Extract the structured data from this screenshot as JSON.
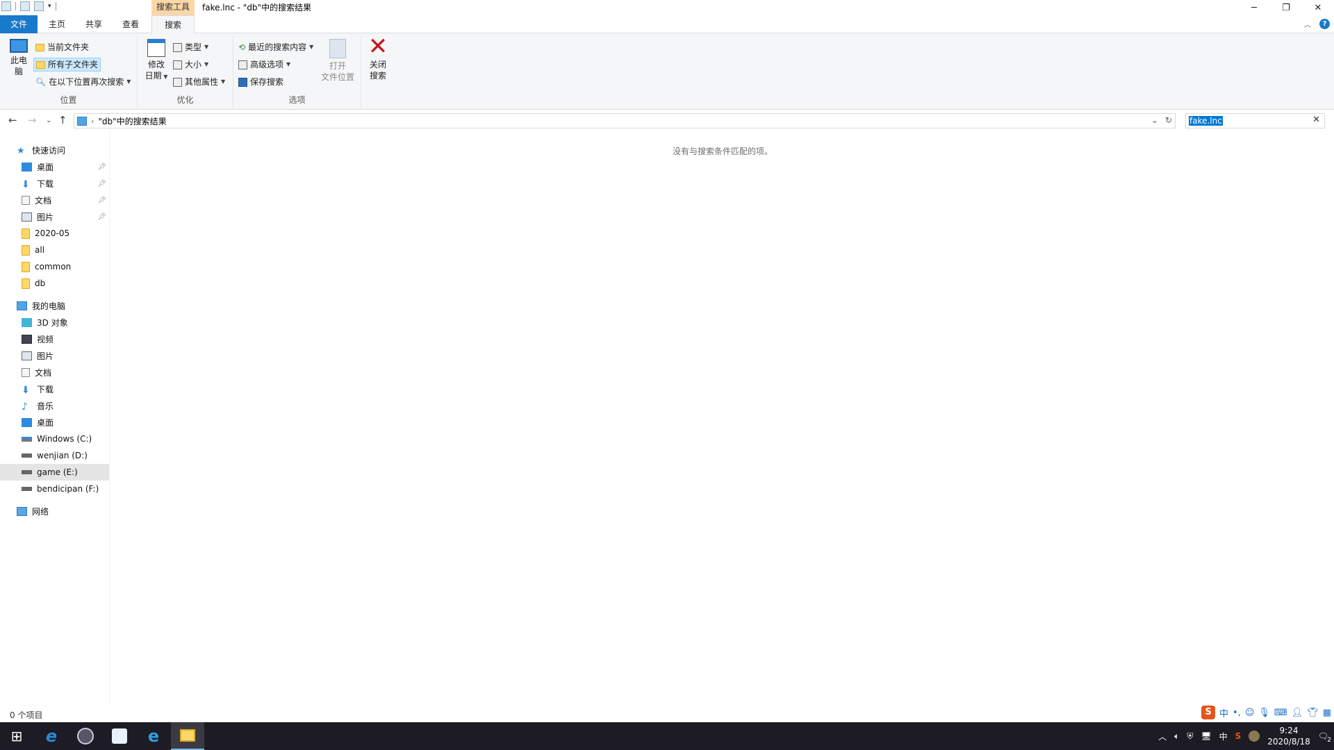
{
  "titlebar": {
    "context_tab": "搜索工具",
    "title": "fake.lnc - \"db\"中的搜索结果"
  },
  "tabs": [
    "文件",
    "主页",
    "共享",
    "查看",
    "搜索"
  ],
  "ribbon": {
    "location": {
      "this_pc_line1": "此电",
      "this_pc_line2": "脑",
      "current_folder": "当前文件夹",
      "all_subfolders": "所有子文件夹",
      "search_again": "在以下位置再次搜索",
      "label": "位置"
    },
    "refine": {
      "date_line1": "修改",
      "date_line2": "日期",
      "type": "类型",
      "size": "大小",
      "other_props": "其他属性",
      "label": "优化"
    },
    "options": {
      "recent": "最近的搜索内容",
      "advanced": "高级选项",
      "save": "保存搜索",
      "open_loc_line1": "打开",
      "open_loc_line2": "文件位置",
      "close_line1": "关闭",
      "close_line2": "搜索",
      "label": "选项"
    }
  },
  "address": {
    "path": "\"db\"中的搜索结果"
  },
  "search": {
    "value": "fake.lnc"
  },
  "sidebar": {
    "quick_access": "快速访问",
    "quick_items": [
      "桌面",
      "下载",
      "文档",
      "图片",
      "2020-05",
      "all",
      "common",
      "db"
    ],
    "my_pc": "我的电脑",
    "pc_items": [
      "3D 对象",
      "视频",
      "图片",
      "文档",
      "下载",
      "音乐",
      "桌面",
      "Windows (C:)",
      "wenjian (D:)",
      "game (E:)",
      "bendicipan (F:)"
    ],
    "network": "网络"
  },
  "content": {
    "empty_message": "没有与搜索条件匹配的项。"
  },
  "status": {
    "count": "0 个项目"
  },
  "ime": {
    "mode": "中",
    "punct": "•,"
  },
  "taskbar": {
    "tray_lang": "中",
    "time": "9:24",
    "date": "2020/8/18",
    "notifications": "2"
  },
  "colors": {
    "file_tab": "#1979ca",
    "context_tab": "#fbd7a8",
    "selection": "#cce8ff",
    "taskbar": "#1d1c24"
  }
}
